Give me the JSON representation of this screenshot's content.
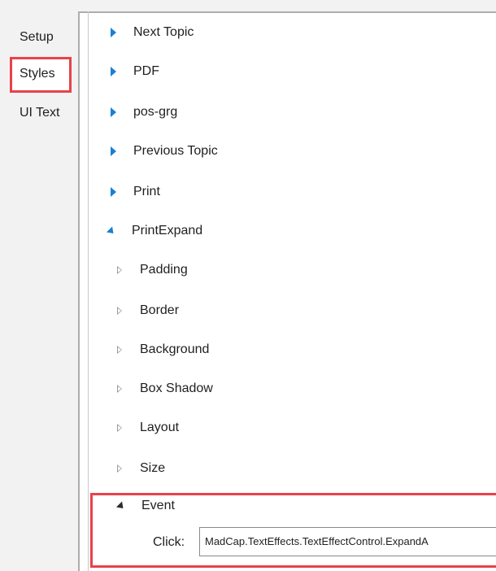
{
  "nav": {
    "items": [
      {
        "label": "Setup"
      },
      {
        "label": "Styles",
        "selected": true
      },
      {
        "label": "UI Text"
      }
    ]
  },
  "tree": {
    "collapsed_top_items": [
      {
        "label": "Next Topic",
        "icon": "expand-arrow-icon"
      },
      {
        "label": "PDF",
        "icon": "expand-arrow-icon"
      },
      {
        "label": "pos-grg",
        "icon": "expand-arrow-icon"
      },
      {
        "label": "Previous Topic",
        "icon": "expand-arrow-icon"
      },
      {
        "label": "Print",
        "icon": "expand-arrow-icon"
      }
    ],
    "expanded_item": {
      "label": "PrintExpand",
      "icon": "collapse-arrow-icon"
    },
    "properties": [
      {
        "label": "Padding",
        "icon": "expand-outline-icon"
      },
      {
        "label": "Border",
        "icon": "expand-outline-icon"
      },
      {
        "label": "Background",
        "icon": "expand-outline-icon"
      },
      {
        "label": "Box Shadow",
        "icon": "expand-outline-icon"
      },
      {
        "label": "Layout",
        "icon": "expand-outline-icon"
      },
      {
        "label": "Size",
        "icon": "expand-outline-icon"
      }
    ],
    "event": {
      "label": "Event",
      "icon": "collapse-arrow-icon",
      "click_label": "Click:",
      "click_value": "MadCap.TextEffects.TextEffectControl.ExpandA"
    }
  },
  "colors": {
    "accent_blue": "#1a7fd4",
    "highlight_red": "#e8424b"
  }
}
